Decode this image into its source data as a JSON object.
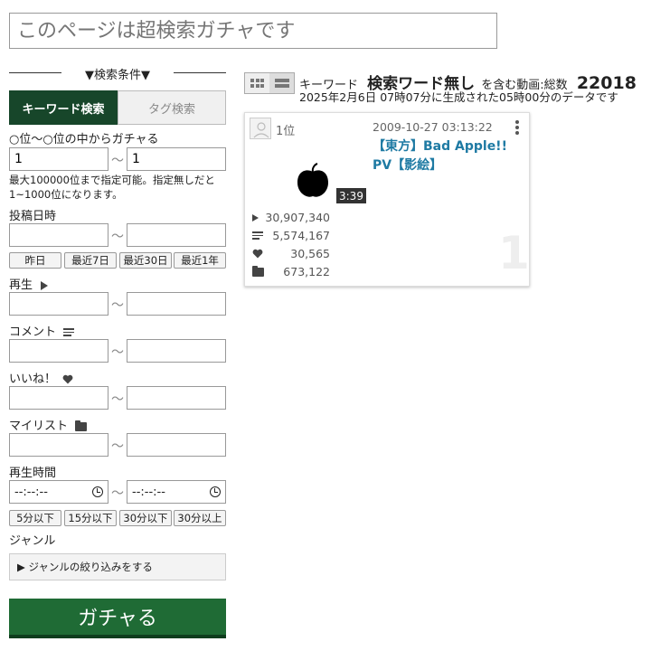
{
  "search": {
    "placeholder": "このページは超検索ガチャです"
  },
  "form": {
    "section_title": "▼検索条件▼",
    "tabs": [
      {
        "label": "キーワード検索",
        "active": true
      },
      {
        "label": "タグ検索",
        "active": false
      }
    ],
    "rank_label": "○位〜○位の中からガチャる",
    "rank_from": "1",
    "rank_to": "1",
    "range_separator": "〜",
    "rank_note": "最大100000位まで指定可能。指定無しだと1~1000位になります。",
    "post_date_label": "投稿日時",
    "date_buttons": [
      "昨日",
      "最近7日",
      "最近30日",
      "最近1年"
    ],
    "views_label": "再生",
    "comments_label": "コメント",
    "likes_label": "いいね！",
    "mylist_label": "マイリスト",
    "duration_label": "再生時間",
    "time_placeholder": "--:--:--",
    "duration_buttons": [
      "5分以下",
      "15分以下",
      "30分以下",
      "30分以上"
    ],
    "genre_label": "ジャンル",
    "genre_toggle": "▶ ジャンルの絞り込みをする",
    "gacha_button": "ガチャる"
  },
  "results": {
    "keyword_prefix": "キーワード",
    "keyword": "検索ワード無し",
    "keyword_suffix": "を含む動画:総数",
    "total": "22018",
    "generated_note": "2025年2月6日 07時07分に生成された05時00分のデータです"
  },
  "video": {
    "rank_label": "1位",
    "posted": "2009-10-27 03:13:22",
    "title": "【東方】Bad Apple!! PV【影絵】",
    "duration": "3:39",
    "views": "30,907,340",
    "comments": "5,574,167",
    "likes": "30,565",
    "mylists": "673,122",
    "rank_number": "1"
  }
}
